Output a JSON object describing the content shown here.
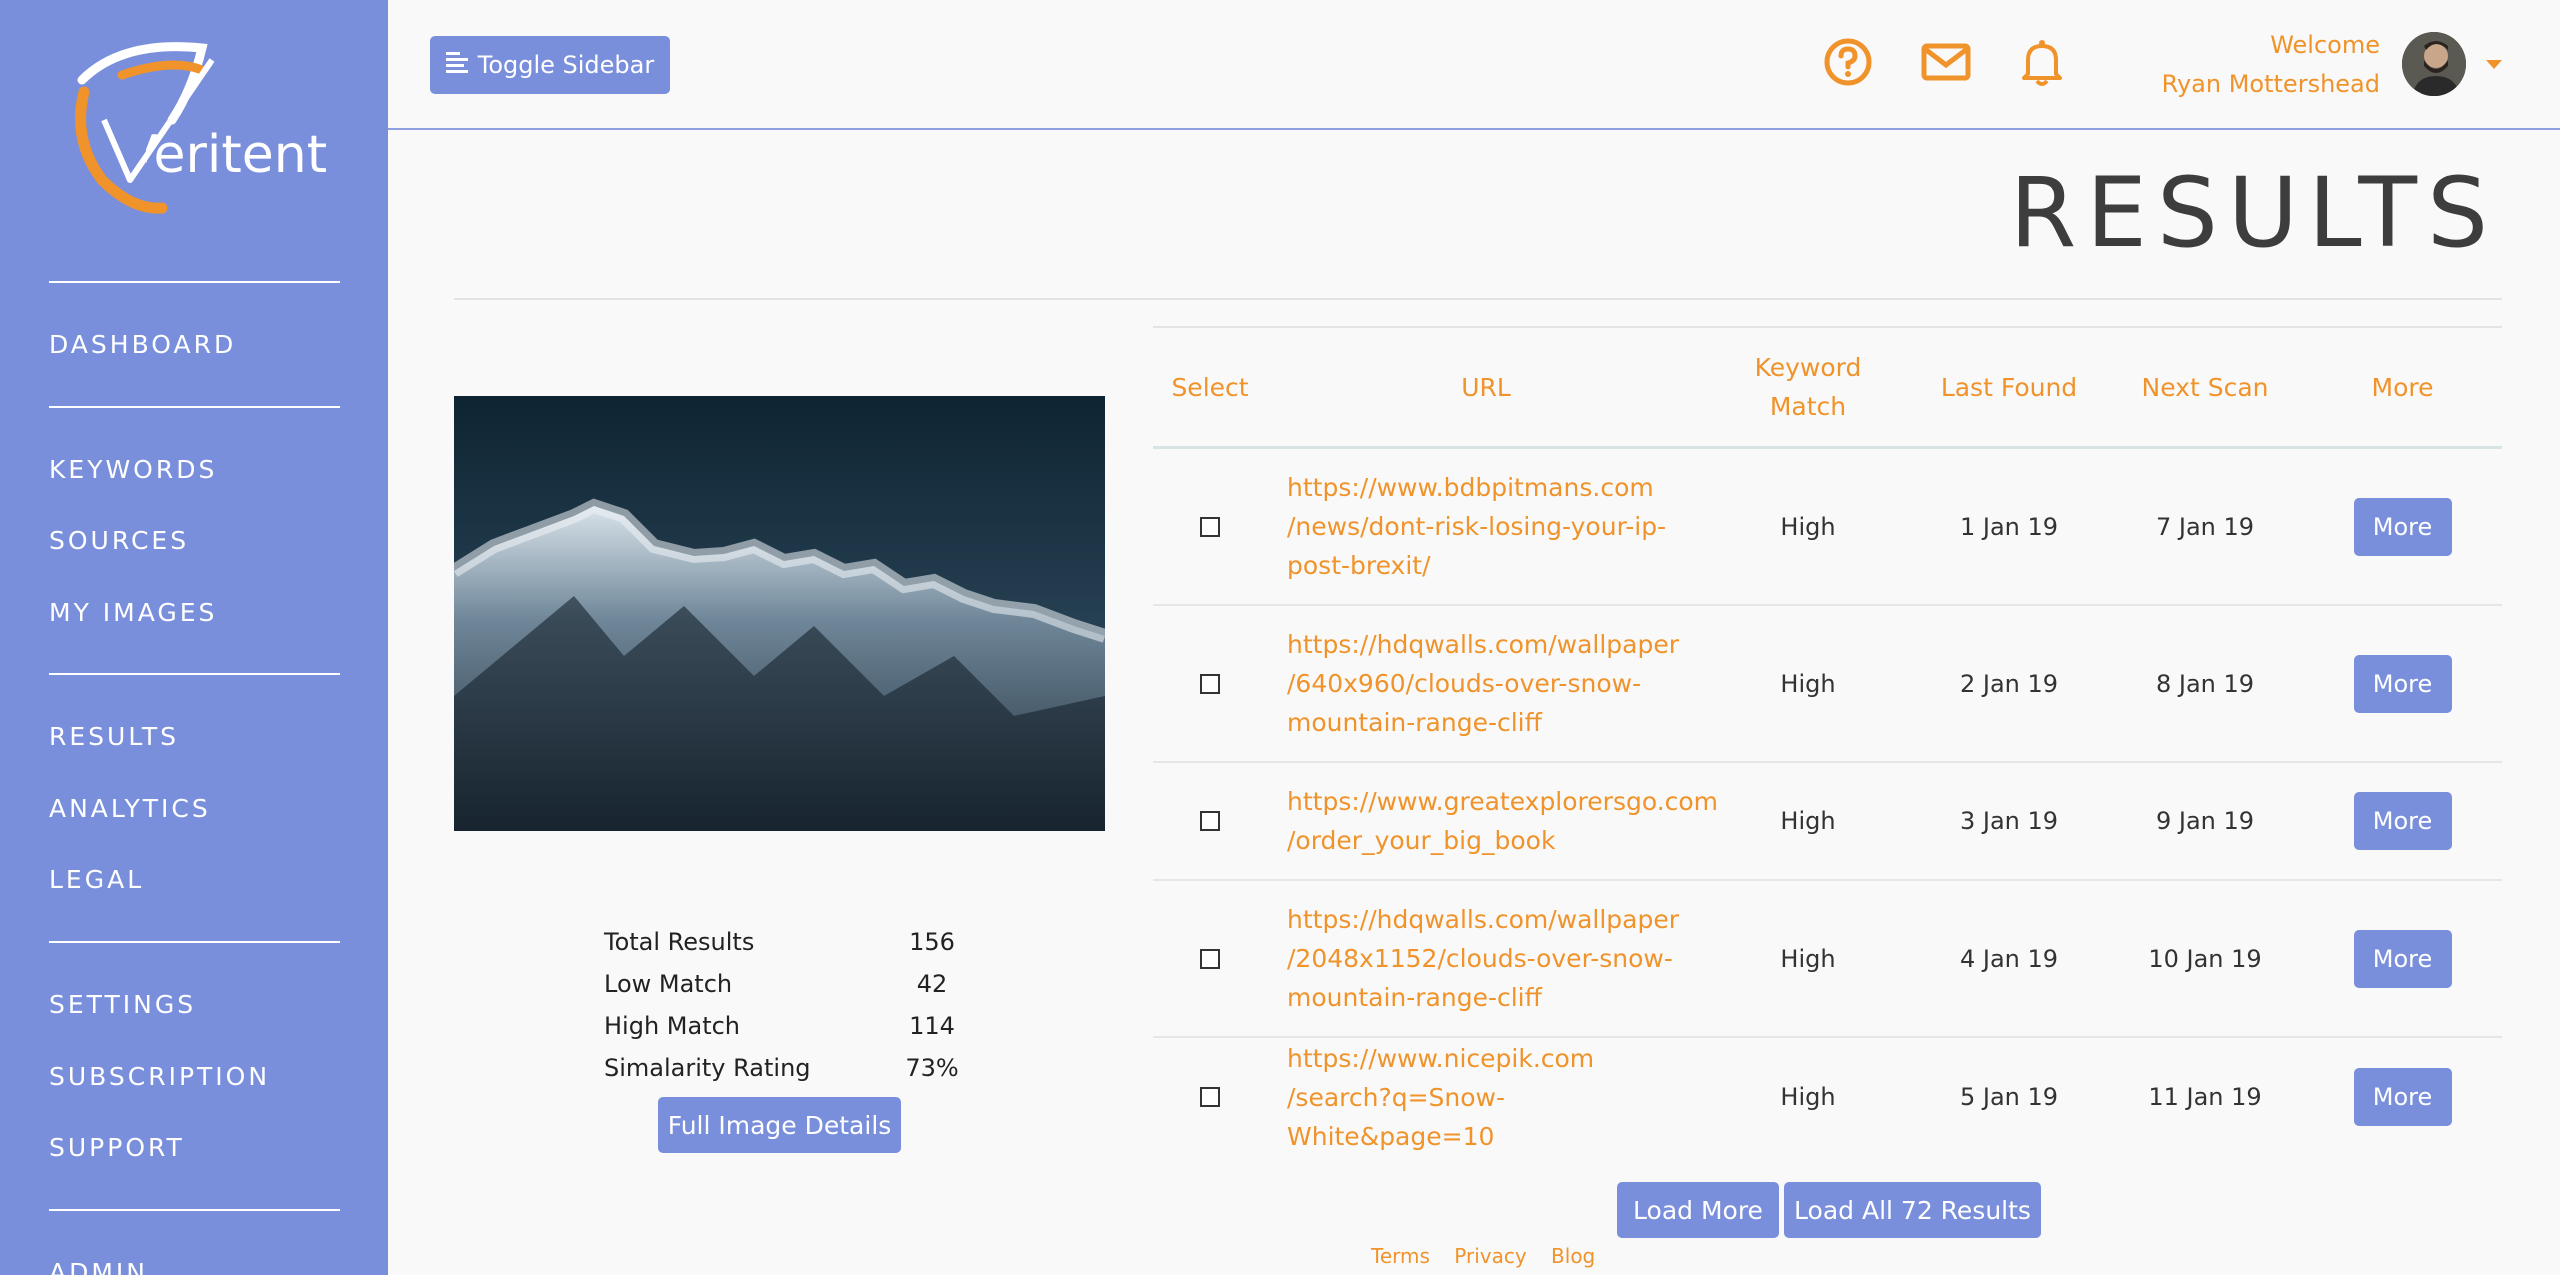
{
  "brand": {
    "logo_text": "Veritent",
    "accent_color": "#f0932b",
    "primary_color": "#7a8fdb"
  },
  "sidebar": {
    "items": [
      {
        "label": "DASHBOARD"
      },
      {
        "label": "KEYWORDS"
      },
      {
        "label": "SOURCES"
      },
      {
        "label": "MY IMAGES"
      },
      {
        "label": "RESULTS"
      },
      {
        "label": "ANALYTICS"
      },
      {
        "label": "LEGAL"
      },
      {
        "label": "SETTINGS"
      },
      {
        "label": "SUBSCRIPTION"
      },
      {
        "label": "SUPPORT"
      },
      {
        "label": "ADMIN"
      }
    ]
  },
  "header": {
    "toggle_label": "Toggle Sidebar",
    "icons": [
      "help-icon",
      "mail-icon",
      "bell-icon"
    ],
    "welcome": "Welcome",
    "user_name": "Ryan Mottershead"
  },
  "page": {
    "title": "RESULTS"
  },
  "stats": [
    {
      "label": "Total Results",
      "value": "156"
    },
    {
      "label": "Low Match",
      "value": "42"
    },
    {
      "label": "High Match",
      "value": "114"
    },
    {
      "label": "Simalarity Rating",
      "value": "73%"
    }
  ],
  "details_button": "Full Image Details",
  "table": {
    "headers": {
      "select": "Select",
      "url": "URL",
      "keyword_match": "Keyword\nMatch",
      "last_found": "Last Found",
      "next_scan": "Next Scan",
      "more": "More"
    },
    "rows": [
      {
        "url": "https://www.bdbpitmans.com\n/news/dont-risk-losing-your-ip-\npost-brexit/",
        "match": "High",
        "last_found": "1 Jan 19",
        "next_scan": "7 Jan 19",
        "more": "More"
      },
      {
        "url": "https://hdqwalls.com/wallpaper\n/640x960/clouds-over-snow-\nmountain-range-cliff",
        "match": "High",
        "last_found": "2 Jan 19",
        "next_scan": "8 Jan 19",
        "more": "More"
      },
      {
        "url": "https://www.greatexplorersgo.com\n/order_your_big_book",
        "match": "High",
        "last_found": "3 Jan 19",
        "next_scan": "9 Jan 19",
        "more": "More"
      },
      {
        "url": "https://hdqwalls.com/wallpaper\n/2048x1152/clouds-over-snow-\nmountain-range-cliff",
        "match": "High",
        "last_found": "4 Jan 19",
        "next_scan": "10 Jan 19",
        "more": "More"
      },
      {
        "url": "https://www.nicepik.com\n/search?q=Snow-White&page=10",
        "match": "High",
        "last_found": "5 Jan 19",
        "next_scan": "11 Jan 19",
        "more": "More"
      }
    ]
  },
  "load_more": "Load More",
  "load_all": "Load All 72 Results",
  "footer": {
    "links": [
      "Terms",
      "Privacy",
      "Blog"
    ]
  }
}
